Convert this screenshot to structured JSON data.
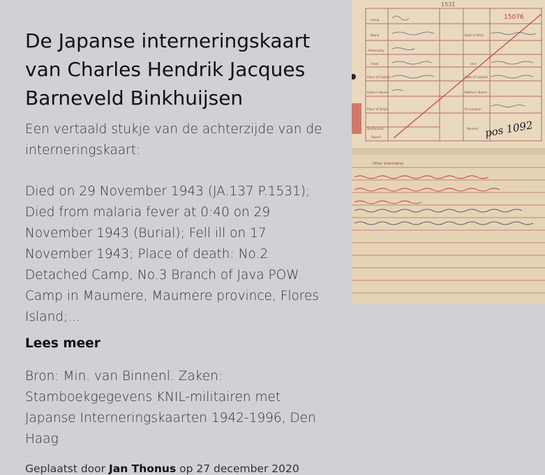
{
  "article": {
    "title": "De Japanse interneringskaart van Charles Hendrik Jacques Barneveld Binkhuijsen",
    "intro": "Een vertaald stukje van de achterzijde van de interneringskaart:",
    "excerpt": "Died on 29 November 1943 (JA.137 P.1531); Died from malaria fever at 0:40 on 29 November 1943 (Burial); Fell ill on 17 November 1943; Place of death: No.2 Detached Camp, No.3 Branch of Java POW Camp in Maumere, Maumere province, Flores Island;...",
    "read_more": "Lees meer",
    "source": "Bron: Min. van Binnenl. Zaken: Stamboekgegevens KNIL-militairen met Japanse Interneringskaarten 1942-1996, Den Haag"
  },
  "meta": {
    "posted_by_prefix": "Geplaatst door",
    "author": "Jan Thonus",
    "date_prefix": "op",
    "date": "27 december 2020"
  },
  "card": {
    "top_number": "1531",
    "card_code": "15076",
    "handwritten_note": "pos 1092",
    "field_labels": [
      "Camp",
      "Name",
      "Nationality",
      "Rank",
      "Place of Capture",
      "Father's Name",
      "Place of Origin",
      "Destination",
      "Report"
    ],
    "right_labels": [
      "Date of Birth",
      "Unit",
      "Date of Capture",
      "Mother's Name",
      "Occupation",
      "Remark"
    ],
    "other_info_label": "Other Information"
  }
}
